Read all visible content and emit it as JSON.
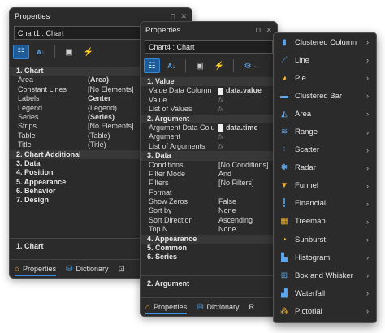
{
  "colors": {
    "accent": "#3a8ee6",
    "window_bg": "#2b2b2b",
    "category_bg": "#383838"
  },
  "win1": {
    "title": "Properties",
    "selector": "Chart1 : Chart",
    "rows": [
      {
        "type": "cat",
        "label": "1. Chart"
      },
      {
        "type": "prop",
        "name": "Area",
        "value": "(Area)",
        "bold": true
      },
      {
        "type": "prop",
        "name": "Constant Lines",
        "value": "[No Elements]"
      },
      {
        "type": "prop",
        "name": "Labels",
        "value": "Center",
        "bold": true
      },
      {
        "type": "prop",
        "name": "Legend",
        "value": "(Legend)"
      },
      {
        "type": "prop",
        "name": "Series",
        "value": "(Series)",
        "bold": true
      },
      {
        "type": "prop",
        "name": "Strips",
        "value": "[No Elements]"
      },
      {
        "type": "prop",
        "name": "Table",
        "value": "(Table)"
      },
      {
        "type": "prop",
        "name": "Title",
        "value": "(Title)"
      },
      {
        "type": "cat",
        "label": "2. Chart  Additional"
      },
      {
        "type": "cat",
        "label": "3. Data",
        "plain": true
      },
      {
        "type": "cat",
        "label": "4. Position",
        "plain": true
      },
      {
        "type": "cat",
        "label": "5. Appearance",
        "plain": true
      },
      {
        "type": "cat",
        "label": "6. Behavior",
        "plain": true
      },
      {
        "type": "cat",
        "label": "7. Design",
        "plain": true
      }
    ],
    "description": "1. Chart",
    "tabs": [
      "Properties",
      "Dictionary"
    ]
  },
  "win2": {
    "title": "Properties",
    "selector": "Chart4 : Chart",
    "rows": [
      {
        "type": "cat",
        "label": "1. Value"
      },
      {
        "type": "prop",
        "name": "Value Data Column",
        "value": "data.value",
        "bold": true,
        "swatch": true
      },
      {
        "type": "prop",
        "name": "Value",
        "value": "fx",
        "fx": true
      },
      {
        "type": "prop",
        "name": "List of Values",
        "value": "fx",
        "fx": true
      },
      {
        "type": "cat",
        "label": "2. Argument"
      },
      {
        "type": "prop",
        "name": "Argument Data Column",
        "value": "data.time",
        "bold": true,
        "swatch": true
      },
      {
        "type": "prop",
        "name": "Argument",
        "value": "fx",
        "fx": true
      },
      {
        "type": "prop",
        "name": "List of Arguments",
        "value": "fx",
        "fx": true
      },
      {
        "type": "cat",
        "label": "3. Data"
      },
      {
        "type": "prop",
        "name": "Conditions",
        "value": "[No Conditions]"
      },
      {
        "type": "prop",
        "name": "Filter Mode",
        "value": "And"
      },
      {
        "type": "prop",
        "name": "Filters",
        "value": "[No Filters]"
      },
      {
        "type": "prop",
        "name": "Format",
        "value": ""
      },
      {
        "type": "prop",
        "name": "Show Zeros",
        "value": "False"
      },
      {
        "type": "prop",
        "name": "Sort by",
        "value": "None"
      },
      {
        "type": "prop",
        "name": "Sort Direction",
        "value": "Ascending"
      },
      {
        "type": "prop",
        "name": "Top N",
        "value": "None"
      },
      {
        "type": "cat",
        "label": "4. Appearance"
      },
      {
        "type": "cat",
        "label": "5. Common",
        "plain": true
      },
      {
        "type": "cat",
        "label": "6. Series",
        "plain": true
      }
    ],
    "description": "2. Argument",
    "tabs": [
      "Properties",
      "Dictionary",
      "R"
    ]
  },
  "menu": [
    {
      "label": "Clustered Column",
      "icon": "clustered-column-icon"
    },
    {
      "label": "Line",
      "icon": "line-chart-icon"
    },
    {
      "label": "Pie",
      "icon": "pie-chart-icon"
    },
    {
      "label": "Clustered Bar",
      "icon": "clustered-bar-icon"
    },
    {
      "label": "Area",
      "icon": "area-chart-icon"
    },
    {
      "label": "Range",
      "icon": "range-chart-icon"
    },
    {
      "label": "Scatter",
      "icon": "scatter-chart-icon"
    },
    {
      "label": "Radar",
      "icon": "radar-chart-icon"
    },
    {
      "label": "Funnel",
      "icon": "funnel-chart-icon"
    },
    {
      "label": "Financial",
      "icon": "financial-chart-icon"
    },
    {
      "label": "Treemap",
      "icon": "treemap-chart-icon"
    },
    {
      "label": "Sunburst",
      "icon": "sunburst-chart-icon"
    },
    {
      "label": "Histogram",
      "icon": "histogram-chart-icon"
    },
    {
      "label": "Box and Whisker",
      "icon": "box-whisker-chart-icon"
    },
    {
      "label": "Waterfall",
      "icon": "waterfall-chart-icon"
    },
    {
      "label": "Pictorial",
      "icon": "pictorial-chart-icon"
    }
  ]
}
